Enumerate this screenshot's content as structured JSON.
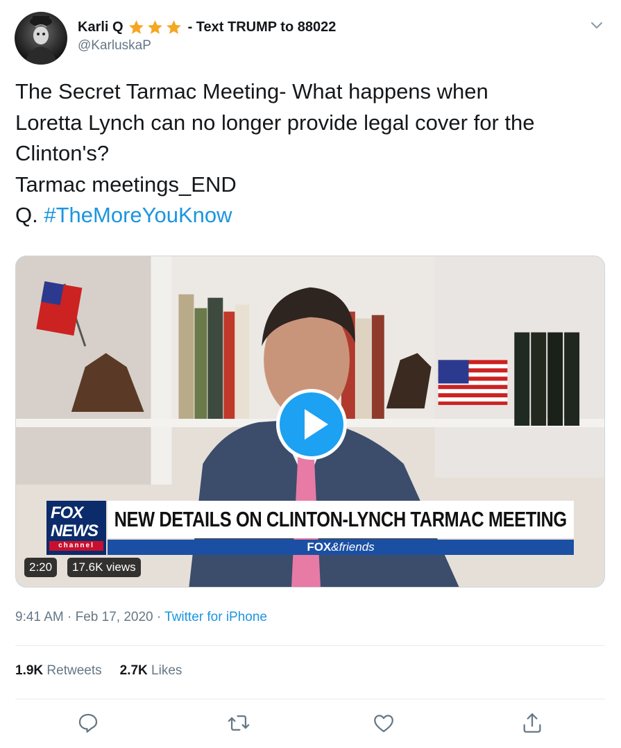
{
  "colors": {
    "accent": "#1da1f2",
    "link": "#1b95e0",
    "muted": "#657786",
    "star": "#f5a623"
  },
  "tweet": {
    "author": {
      "name": "Karli Q",
      "stars": 3,
      "name_suffix": "- Text TRUMP to 88022",
      "handle": "@KarluskaP"
    },
    "text_lines": [
      "The Secret Tarmac Meeting- What happens when",
      "Loretta Lynch can no longer provide legal cover for the",
      "Clinton's?",
      "Tarmac meetings_END"
    ],
    "last_line_prefix": "Q.",
    "hashtag": "#TheMoreYouKnow",
    "video": {
      "headline": "NEW DETAILS ON CLINTON-LYNCH TARMAC MEETING",
      "show_fox": "FOX",
      "show_friends": "&friends",
      "logo_fox": "FOX",
      "logo_news": "NEWS",
      "logo_channel": "channel",
      "duration": "2:20",
      "views": "17.6K views"
    },
    "time": "9:41 AM",
    "date": "Feb 17, 2020",
    "separator": "·",
    "source": "Twitter for iPhone",
    "retweets_count": "1.9K",
    "retweets_label": "Retweets",
    "likes_count": "2.7K",
    "likes_label": "Likes"
  },
  "icons": [
    "chevron-down-icon",
    "star-icon",
    "play-icon",
    "reply-icon",
    "retweet-icon",
    "like-icon",
    "share-icon"
  ]
}
